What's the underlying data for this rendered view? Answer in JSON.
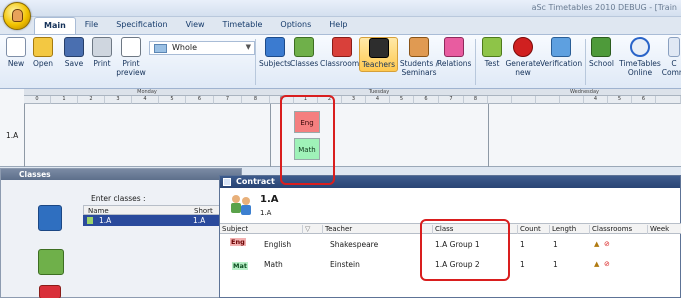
{
  "window": {
    "title": "aSc Timetables 2010  DEBUG - [Train"
  },
  "menu": {
    "tabs": [
      "Main",
      "File",
      "Specification",
      "View",
      "Timetable",
      "Options",
      "Help"
    ],
    "active": "Main"
  },
  "ribbon": {
    "buttons_left": [
      {
        "label": "New",
        "icon": "new-file-icon"
      },
      {
        "label": "Open",
        "icon": "open-folder-icon"
      },
      {
        "label": "Save",
        "icon": "save-disk-icon"
      },
      {
        "label": "Print",
        "icon": "printer-icon"
      },
      {
        "label": "Print\npreview",
        "icon": "print-preview-icon"
      }
    ],
    "view_dropdown": "Whole",
    "buttons_right": [
      {
        "label": "Subjects",
        "icon": "subjects-book-icon"
      },
      {
        "label": "Classes",
        "icon": "classes-group-icon"
      },
      {
        "label": "Classrooms",
        "icon": "classroom-icon"
      },
      {
        "label": "Teachers",
        "icon": "teacher-icon",
        "highlighted": true
      },
      {
        "label": "Students /\nSeminars",
        "icon": "students-icon"
      },
      {
        "label": "Relations",
        "icon": "relations-icon"
      },
      {
        "label": "Test",
        "icon": "test-icon"
      },
      {
        "label": "Generate\nnew",
        "icon": "generate-icon"
      },
      {
        "label": "Verification",
        "icon": "verification-icon"
      },
      {
        "label": "School",
        "icon": "school-icon"
      },
      {
        "label": "TimeTables\nOnline",
        "icon": "timetables-online-icon"
      },
      {
        "label": "C\nComm",
        "icon": "community-icon"
      }
    ]
  },
  "grid": {
    "days": [
      "Monday",
      "Tuesday",
      "Wednesday"
    ],
    "slots_monday": [
      "0",
      "1",
      "2",
      "3",
      "4",
      "5",
      "6",
      "7",
      "8"
    ],
    "slots_tuesday": [
      "0",
      "1",
      "2",
      "3",
      "4",
      "5",
      "6",
      "7",
      "8"
    ],
    "slots_wednesday": [
      "4",
      "5",
      "6"
    ],
    "row_label": "1.A",
    "cards": [
      {
        "label": "Eng",
        "color": "#f47f7f"
      },
      {
        "label": "Math",
        "color": "#9ff2b8"
      }
    ]
  },
  "classes_panel": {
    "title": "Classes",
    "enter_label": "Enter classes :",
    "columns": [
      "Name",
      "Short"
    ],
    "rows": [
      {
        "name": "1.A",
        "short": "1.A"
      }
    ]
  },
  "contract": {
    "title": "Contract",
    "class_name": "1.A",
    "class_short": "1.A",
    "columns": [
      "Subject",
      "Teacher",
      "Class",
      "Count",
      "Length",
      "Classrooms",
      "Week"
    ],
    "rows": [
      {
        "badge": "Eng",
        "subject": "English",
        "teacher": "Shakespeare",
        "class": "1.A Group 1",
        "count": "1",
        "length": "1"
      },
      {
        "badge": "Mat",
        "subject": "Math",
        "teacher": "Einstein",
        "class": "1.A Group 2",
        "count": "1",
        "length": "1"
      }
    ]
  },
  "colors": {
    "highlight": "#d91e1e",
    "selection": "#2a4a9c",
    "ribbon_active": "#ffc94f"
  }
}
